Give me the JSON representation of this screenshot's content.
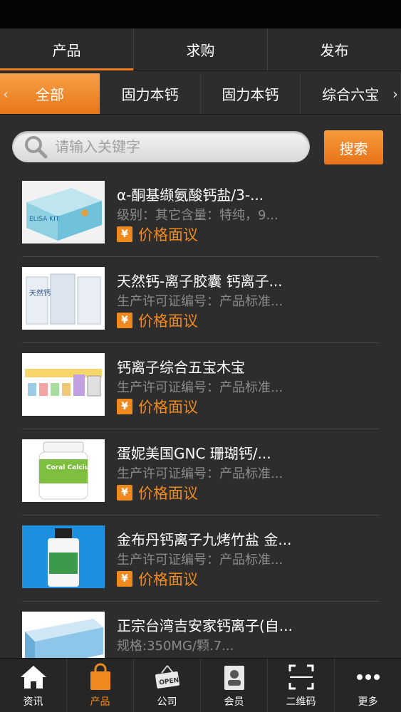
{
  "main_tabs": [
    {
      "label": "产品"
    },
    {
      "label": "求购"
    },
    {
      "label": "发布"
    }
  ],
  "categories": {
    "left_arrow": "‹",
    "right_arrow": "›",
    "items": [
      {
        "label": "全部"
      },
      {
        "label": "固力本钙"
      },
      {
        "label": "固力本钙"
      },
      {
        "label": "综合六宝"
      }
    ]
  },
  "search": {
    "placeholder": "请输入关键字",
    "button": "搜索"
  },
  "products": [
    {
      "title": "α-酮基缬氨酸钙盐/3-...",
      "desc": "级别：其它含量：特纯，9...",
      "price": "价格面议"
    },
    {
      "title": "天然钙-离子胶囊 钙离子...",
      "desc": "生产许可证编号：产品标准...",
      "price": "价格面议"
    },
    {
      "title": "钙离子综合五宝木宝",
      "desc": "生产许可证编号：产品标准...",
      "price": "价格面议"
    },
    {
      "title": "蛋妮美国GNC 珊瑚钙/...",
      "desc": "生产许可证编号：产品标准...",
      "price": "价格面议"
    },
    {
      "title": "金布丹钙离子九烤竹盐 金...",
      "desc": "生产许可证编号：产品标准...",
      "price": "价格面议"
    },
    {
      "title": "正宗台湾吉安家钙离子(自...",
      "desc": "规格:350MG/颗.7...",
      "price": ""
    }
  ],
  "thumb_text": {
    "elisa": "ELISA KIT",
    "tianran": "天然钙",
    "coral": "Coral Calcium"
  },
  "price_symbol": "¥",
  "bottom_nav": [
    {
      "label": "资讯",
      "icon": "home-icon"
    },
    {
      "label": "产品",
      "icon": "bag-icon"
    },
    {
      "label": "公司",
      "icon": "open-sign-icon"
    },
    {
      "label": "会员",
      "icon": "member-card-icon"
    },
    {
      "label": "二维码",
      "icon": "qr-scan-icon"
    },
    {
      "label": "更多",
      "icon": "more-dots-icon"
    }
  ],
  "colors": {
    "accent": "#f08a1e",
    "background": "#2d2d2d"
  }
}
